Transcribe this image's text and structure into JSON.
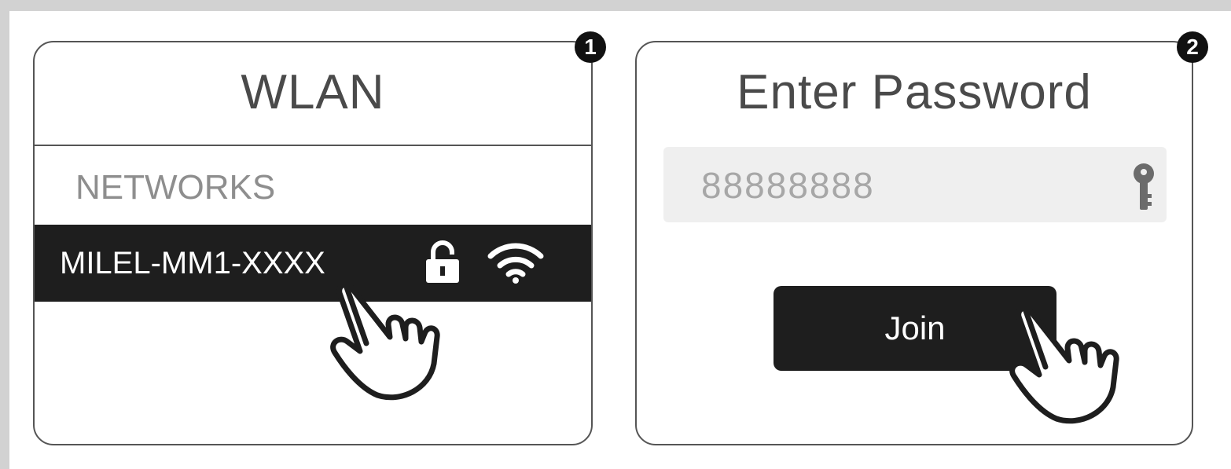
{
  "steps": [
    {
      "badge": "1",
      "title": "WLAN",
      "section_label": "NETWORKS",
      "network": {
        "name": "MILEL-MM1-XXXX",
        "lock_icon": "lock-icon",
        "signal_icon": "wifi-icon"
      },
      "pointer_icon": "pointing-hand-icon"
    },
    {
      "badge": "2",
      "title": "Enter Password",
      "password_value": "88888888",
      "field_icon": "key-icon",
      "join_label": "Join",
      "pointer_icon": "pointing-hand-icon"
    }
  ],
  "colors": {
    "frame": "#d2d2d2",
    "dark": "#1e1e1e",
    "border": "#555555",
    "field_bg": "#efefef",
    "muted_text": "#8e8e8e"
  }
}
